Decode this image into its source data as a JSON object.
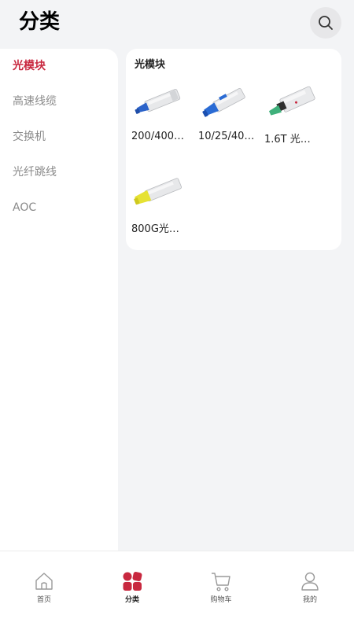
{
  "header": {
    "title": "分类",
    "search_icon": "search-icon"
  },
  "sidebar": {
    "items": [
      {
        "label": "光模块",
        "active": true
      },
      {
        "label": "高速线缆",
        "active": false
      },
      {
        "label": "交换机",
        "active": false
      },
      {
        "label": "光纤跳线",
        "active": false
      },
      {
        "label": "AOC",
        "active": false
      }
    ]
  },
  "content": {
    "section_title": "光模块",
    "products": [
      {
        "name": "200/400…",
        "color": "#2c63c9"
      },
      {
        "name": "10/25/40…",
        "color": "#2a6bd4"
      },
      {
        "name": "1.6T 光…",
        "color": "#3fb07b"
      },
      {
        "name": "800G光…",
        "color": "#e6e233"
      }
    ]
  },
  "tabbar": {
    "tabs": [
      {
        "label": "首页",
        "icon": "home-icon",
        "active": false
      },
      {
        "label": "分类",
        "icon": "category-icon",
        "active": true
      },
      {
        "label": "购物车",
        "icon": "cart-icon",
        "active": false
      },
      {
        "label": "我的",
        "icon": "profile-icon",
        "active": false
      }
    ]
  },
  "colors": {
    "accent": "#c8283f",
    "background": "#f3f4f6"
  }
}
